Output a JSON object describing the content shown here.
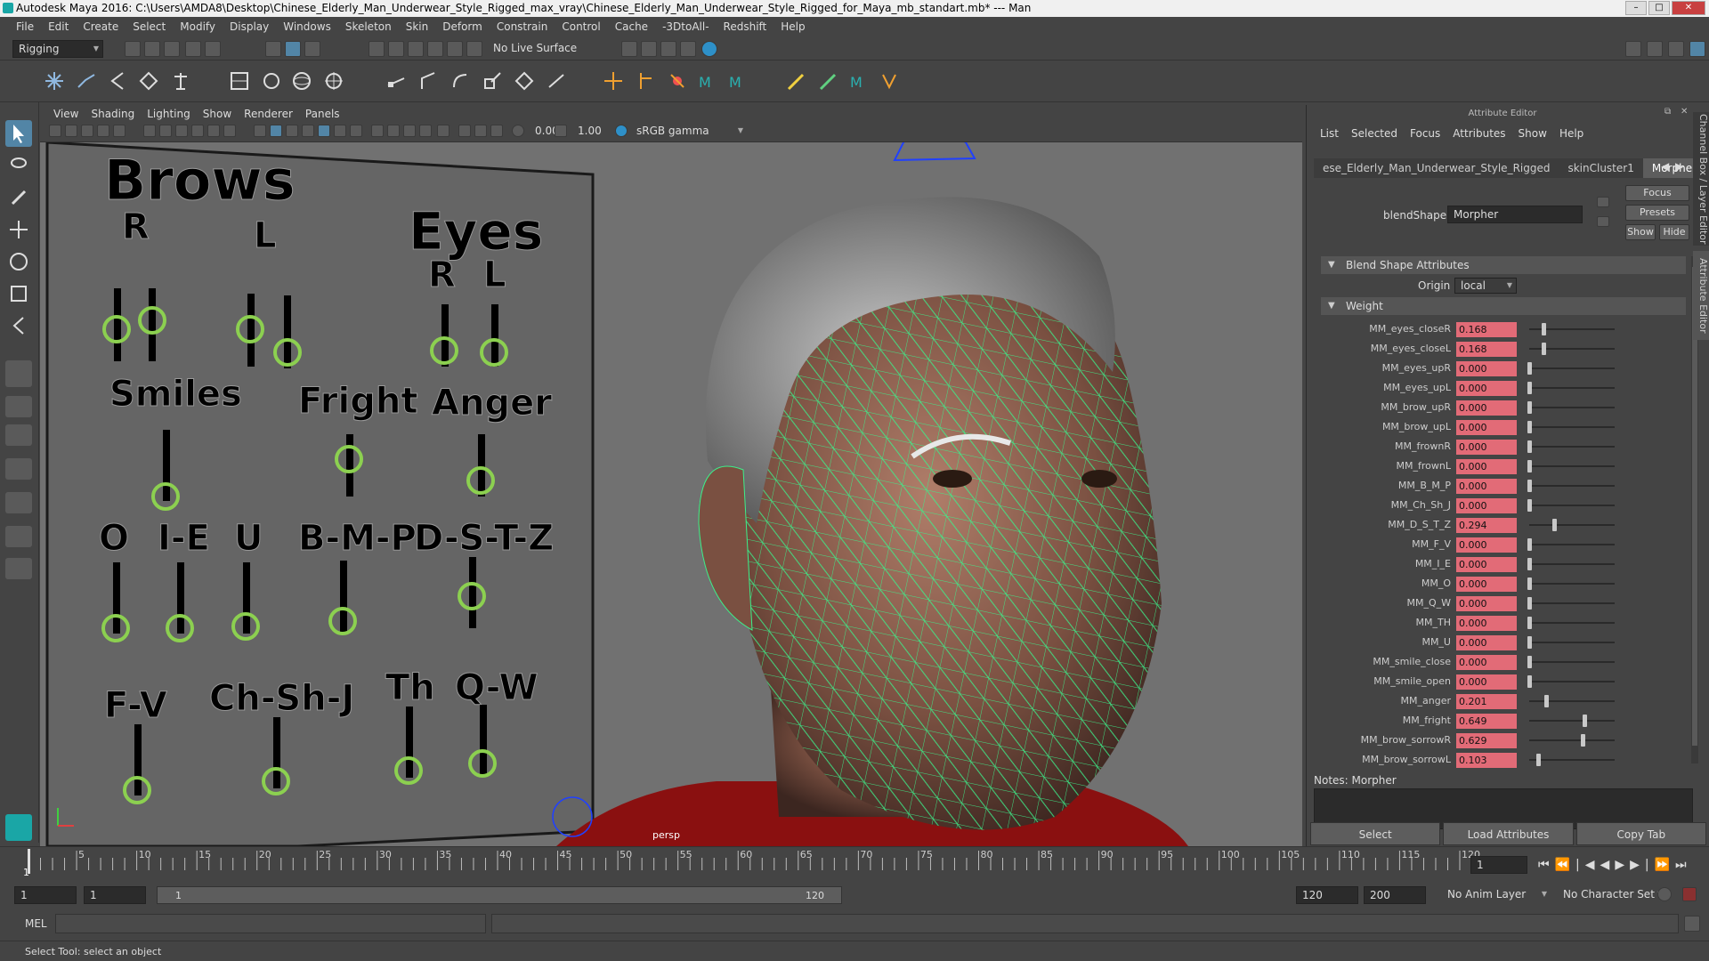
{
  "window": {
    "title": "Autodesk Maya 2016: C:\\Users\\AMDA8\\Desktop\\Chinese_Elderly_Man_Underwear_Style_Rigged_max_vray\\Chinese_Elderly_Man_Underwear_Style_Rigged_for_Maya_mb_standart.mb*   ---   Man"
  },
  "menubar": [
    "File",
    "Edit",
    "Create",
    "Select",
    "Modify",
    "Display",
    "Windows",
    "Skeleton",
    "Skin",
    "Deform",
    "Constrain",
    "Control",
    "Cache",
    "-3DtoAll-",
    "Redshift",
    "Help"
  ],
  "statusline": {
    "menuset": "Rigging",
    "live_surface": "No Live Surface"
  },
  "viewport": {
    "menu": [
      "View",
      "Shading",
      "Lighting",
      "Show",
      "Renderer",
      "Panels"
    ],
    "exposure": "0.00",
    "gamma": "1.00",
    "colorspace": "sRGB gamma",
    "camera_label": "persp",
    "board": {
      "brows": "Brows",
      "brows_r": "R",
      "brows_l": "L",
      "eyes": "Eyes",
      "eyes_r": "R",
      "eyes_l": "L",
      "smiles": "Smiles",
      "fright": "Fright",
      "anger": "Anger",
      "o": "O",
      "ie": "I-E",
      "u": "U",
      "bmp": "B-M-P",
      "dstz": "D-S-T-Z",
      "fv": "F-V",
      "chshj": "Ch-Sh-J",
      "th": "Th",
      "qw": "Q-W"
    }
  },
  "attribute_editor": {
    "header": "Attribute Editor",
    "menu": [
      "List",
      "Selected",
      "Focus",
      "Attributes",
      "Show",
      "Help"
    ],
    "tabs": [
      "ese_Elderly_Man_Underwear_Style_Rigged",
      "skinCluster1",
      "Morpher"
    ],
    "blendshape_label": "blendShape:",
    "blendshape_value": "Morpher",
    "focus_btn": "Focus",
    "presets_btn": "Presets",
    "show_btn": "Show",
    "hide_btn": "Hide",
    "section_blend": "Blend Shape Attributes",
    "origin_label": "Origin",
    "origin_value": "local",
    "section_weight": "Weight",
    "weights": [
      {
        "name": "MM_eyes_closeR",
        "value": "0.168",
        "level": 0.168
      },
      {
        "name": "MM_eyes_closeL",
        "value": "0.168",
        "level": 0.168
      },
      {
        "name": "MM_eyes_upR",
        "value": "0.000",
        "level": 0
      },
      {
        "name": "MM_eyes_upL",
        "value": "0.000",
        "level": 0
      },
      {
        "name": "MM_brow_upR",
        "value": "0.000",
        "level": 0
      },
      {
        "name": "MM_brow_upL",
        "value": "0.000",
        "level": 0
      },
      {
        "name": "MM_frownR",
        "value": "0.000",
        "level": 0
      },
      {
        "name": "MM_frownL",
        "value": "0.000",
        "level": 0
      },
      {
        "name": "MM_B_M_P",
        "value": "0.000",
        "level": 0
      },
      {
        "name": "MM_Ch_Sh_J",
        "value": "0.000",
        "level": 0
      },
      {
        "name": "MM_D_S_T_Z",
        "value": "0.294",
        "level": 0.294
      },
      {
        "name": "MM_F_V",
        "value": "0.000",
        "level": 0
      },
      {
        "name": "MM_I_E",
        "value": "0.000",
        "level": 0
      },
      {
        "name": "MM_O",
        "value": "0.000",
        "level": 0
      },
      {
        "name": "MM_Q_W",
        "value": "0.000",
        "level": 0
      },
      {
        "name": "MM_TH",
        "value": "0.000",
        "level": 0
      },
      {
        "name": "MM_U",
        "value": "0.000",
        "level": 0
      },
      {
        "name": "MM_smile_close",
        "value": "0.000",
        "level": 0
      },
      {
        "name": "MM_smile_open",
        "value": "0.000",
        "level": 0
      },
      {
        "name": "MM_anger",
        "value": "0.201",
        "level": 0.201
      },
      {
        "name": "MM_fright",
        "value": "0.649",
        "level": 0.649
      },
      {
        "name": "MM_brow_sorrowR",
        "value": "0.629",
        "level": 0.629
      },
      {
        "name": "MM_brow_sorrowL",
        "value": "0.103",
        "level": 0.103
      }
    ],
    "notes_label": "Notes:",
    "notes_value": "Morpher",
    "bottom": [
      "Select",
      "Load Attributes",
      "Copy Tab"
    ],
    "side_tabs": [
      "Channel Box / Layer Editor",
      "Attribute Editor"
    ]
  },
  "timeline": {
    "ticks": [
      "5",
      "10",
      "15",
      "20",
      "25",
      "30",
      "35",
      "40",
      "45",
      "50",
      "55",
      "60",
      "65",
      "70",
      "75",
      "80",
      "85",
      "90",
      "95",
      "100",
      "105",
      "110",
      "115",
      "120"
    ],
    "start_tick": "1",
    "current_frame": "1"
  },
  "range": {
    "start": "1",
    "playback_start": "1",
    "slider_start": "1",
    "slider_end": "120",
    "playback_end": "120",
    "end": "200",
    "anim_layer": "No Anim Layer",
    "char_set": "No Character Set"
  },
  "cmdline": {
    "label": "MEL"
  },
  "helpline": {
    "text": "Select Tool: select an object"
  }
}
